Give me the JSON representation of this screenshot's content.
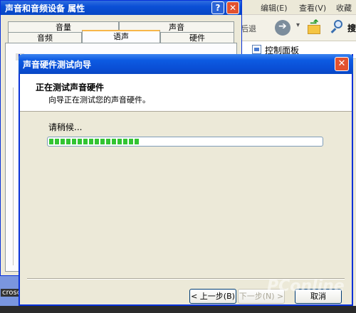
{
  "explorer": {
    "menus": [
      "编辑(E)",
      "查看(V)",
      "收藏"
    ],
    "back_label": "后退",
    "search_label": "搜",
    "address_text": "控制面板"
  },
  "props": {
    "title": "声音和音频设备 属性",
    "help_btn": "?",
    "close_btn": "✕",
    "tabs_top": [
      "音量",
      "声音"
    ],
    "tabs_bottom": [
      "音频",
      "语声",
      "硬件"
    ],
    "taskbar_fragment": "croso"
  },
  "wizard": {
    "title": "声音硬件测试向导",
    "close_btn": "✕",
    "header_title": "正在测试声音硬件",
    "header_subtitle": "向导正在测试您的声音硬件。",
    "status_text": "请稍候...",
    "progress": 0.33,
    "buttons": {
      "back": "< 上一步(B)",
      "next": "下一步(N) >",
      "cancel": "取消"
    }
  },
  "watermark": "PConline",
  "colors": {
    "titlebar": "#0a4fd6",
    "progress_fill": "#33c433",
    "dialog_bg": "#ece9d8"
  }
}
